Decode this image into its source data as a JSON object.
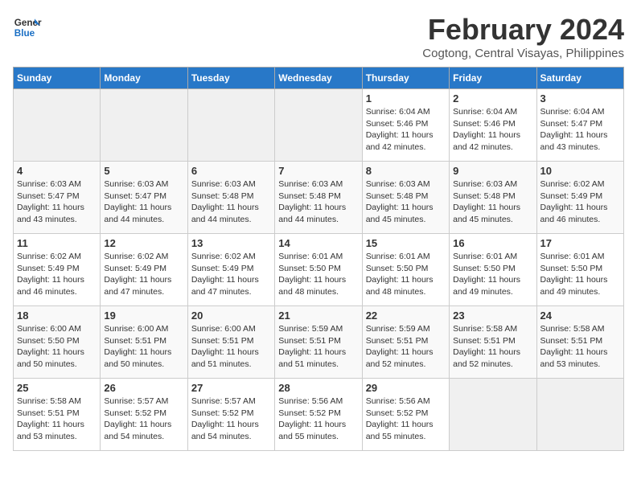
{
  "header": {
    "logo_line1": "General",
    "logo_line2": "Blue",
    "month_year": "February 2024",
    "location": "Cogtong, Central Visayas, Philippines"
  },
  "weekdays": [
    "Sunday",
    "Monday",
    "Tuesday",
    "Wednesday",
    "Thursday",
    "Friday",
    "Saturday"
  ],
  "weeks": [
    [
      {
        "day": "",
        "info": ""
      },
      {
        "day": "",
        "info": ""
      },
      {
        "day": "",
        "info": ""
      },
      {
        "day": "",
        "info": ""
      },
      {
        "day": "1",
        "info": "Sunrise: 6:04 AM\nSunset: 5:46 PM\nDaylight: 11 hours\nand 42 minutes."
      },
      {
        "day": "2",
        "info": "Sunrise: 6:04 AM\nSunset: 5:46 PM\nDaylight: 11 hours\nand 42 minutes."
      },
      {
        "day": "3",
        "info": "Sunrise: 6:04 AM\nSunset: 5:47 PM\nDaylight: 11 hours\nand 43 minutes."
      }
    ],
    [
      {
        "day": "4",
        "info": "Sunrise: 6:03 AM\nSunset: 5:47 PM\nDaylight: 11 hours\nand 43 minutes."
      },
      {
        "day": "5",
        "info": "Sunrise: 6:03 AM\nSunset: 5:47 PM\nDaylight: 11 hours\nand 44 minutes."
      },
      {
        "day": "6",
        "info": "Sunrise: 6:03 AM\nSunset: 5:48 PM\nDaylight: 11 hours\nand 44 minutes."
      },
      {
        "day": "7",
        "info": "Sunrise: 6:03 AM\nSunset: 5:48 PM\nDaylight: 11 hours\nand 44 minutes."
      },
      {
        "day": "8",
        "info": "Sunrise: 6:03 AM\nSunset: 5:48 PM\nDaylight: 11 hours\nand 45 minutes."
      },
      {
        "day": "9",
        "info": "Sunrise: 6:03 AM\nSunset: 5:48 PM\nDaylight: 11 hours\nand 45 minutes."
      },
      {
        "day": "10",
        "info": "Sunrise: 6:02 AM\nSunset: 5:49 PM\nDaylight: 11 hours\nand 46 minutes."
      }
    ],
    [
      {
        "day": "11",
        "info": "Sunrise: 6:02 AM\nSunset: 5:49 PM\nDaylight: 11 hours\nand 46 minutes."
      },
      {
        "day": "12",
        "info": "Sunrise: 6:02 AM\nSunset: 5:49 PM\nDaylight: 11 hours\nand 47 minutes."
      },
      {
        "day": "13",
        "info": "Sunrise: 6:02 AM\nSunset: 5:49 PM\nDaylight: 11 hours\nand 47 minutes."
      },
      {
        "day": "14",
        "info": "Sunrise: 6:01 AM\nSunset: 5:50 PM\nDaylight: 11 hours\nand 48 minutes."
      },
      {
        "day": "15",
        "info": "Sunrise: 6:01 AM\nSunset: 5:50 PM\nDaylight: 11 hours\nand 48 minutes."
      },
      {
        "day": "16",
        "info": "Sunrise: 6:01 AM\nSunset: 5:50 PM\nDaylight: 11 hours\nand 49 minutes."
      },
      {
        "day": "17",
        "info": "Sunrise: 6:01 AM\nSunset: 5:50 PM\nDaylight: 11 hours\nand 49 minutes."
      }
    ],
    [
      {
        "day": "18",
        "info": "Sunrise: 6:00 AM\nSunset: 5:50 PM\nDaylight: 11 hours\nand 50 minutes."
      },
      {
        "day": "19",
        "info": "Sunrise: 6:00 AM\nSunset: 5:51 PM\nDaylight: 11 hours\nand 50 minutes."
      },
      {
        "day": "20",
        "info": "Sunrise: 6:00 AM\nSunset: 5:51 PM\nDaylight: 11 hours\nand 51 minutes."
      },
      {
        "day": "21",
        "info": "Sunrise: 5:59 AM\nSunset: 5:51 PM\nDaylight: 11 hours\nand 51 minutes."
      },
      {
        "day": "22",
        "info": "Sunrise: 5:59 AM\nSunset: 5:51 PM\nDaylight: 11 hours\nand 52 minutes."
      },
      {
        "day": "23",
        "info": "Sunrise: 5:58 AM\nSunset: 5:51 PM\nDaylight: 11 hours\nand 52 minutes."
      },
      {
        "day": "24",
        "info": "Sunrise: 5:58 AM\nSunset: 5:51 PM\nDaylight: 11 hours\nand 53 minutes."
      }
    ],
    [
      {
        "day": "25",
        "info": "Sunrise: 5:58 AM\nSunset: 5:51 PM\nDaylight: 11 hours\nand 53 minutes."
      },
      {
        "day": "26",
        "info": "Sunrise: 5:57 AM\nSunset: 5:52 PM\nDaylight: 11 hours\nand 54 minutes."
      },
      {
        "day": "27",
        "info": "Sunrise: 5:57 AM\nSunset: 5:52 PM\nDaylight: 11 hours\nand 54 minutes."
      },
      {
        "day": "28",
        "info": "Sunrise: 5:56 AM\nSunset: 5:52 PM\nDaylight: 11 hours\nand 55 minutes."
      },
      {
        "day": "29",
        "info": "Sunrise: 5:56 AM\nSunset: 5:52 PM\nDaylight: 11 hours\nand 55 minutes."
      },
      {
        "day": "",
        "info": ""
      },
      {
        "day": "",
        "info": ""
      }
    ]
  ]
}
